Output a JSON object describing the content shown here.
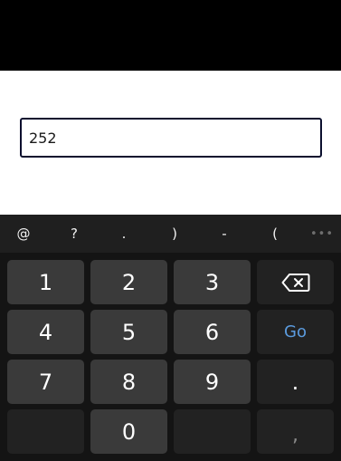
{
  "input": {
    "value": "252"
  },
  "keyboard": {
    "symbols": [
      "@",
      "?",
      ".",
      ")",
      "-",
      "("
    ],
    "more_icon": "more-horizontal-icon",
    "keys": {
      "one": "1",
      "two": "2",
      "three": "3",
      "four": "4",
      "five": "5",
      "six": "6",
      "seven": "7",
      "eight": "8",
      "nine": "9",
      "zero": "0",
      "dot": ".",
      "comma": ",",
      "go": "Go"
    },
    "backspace_icon": "backspace-icon",
    "colors": {
      "background": "#141414",
      "key": "#3a3a3a",
      "key_dark": "#222222",
      "go_text": "#5b9bde"
    }
  }
}
